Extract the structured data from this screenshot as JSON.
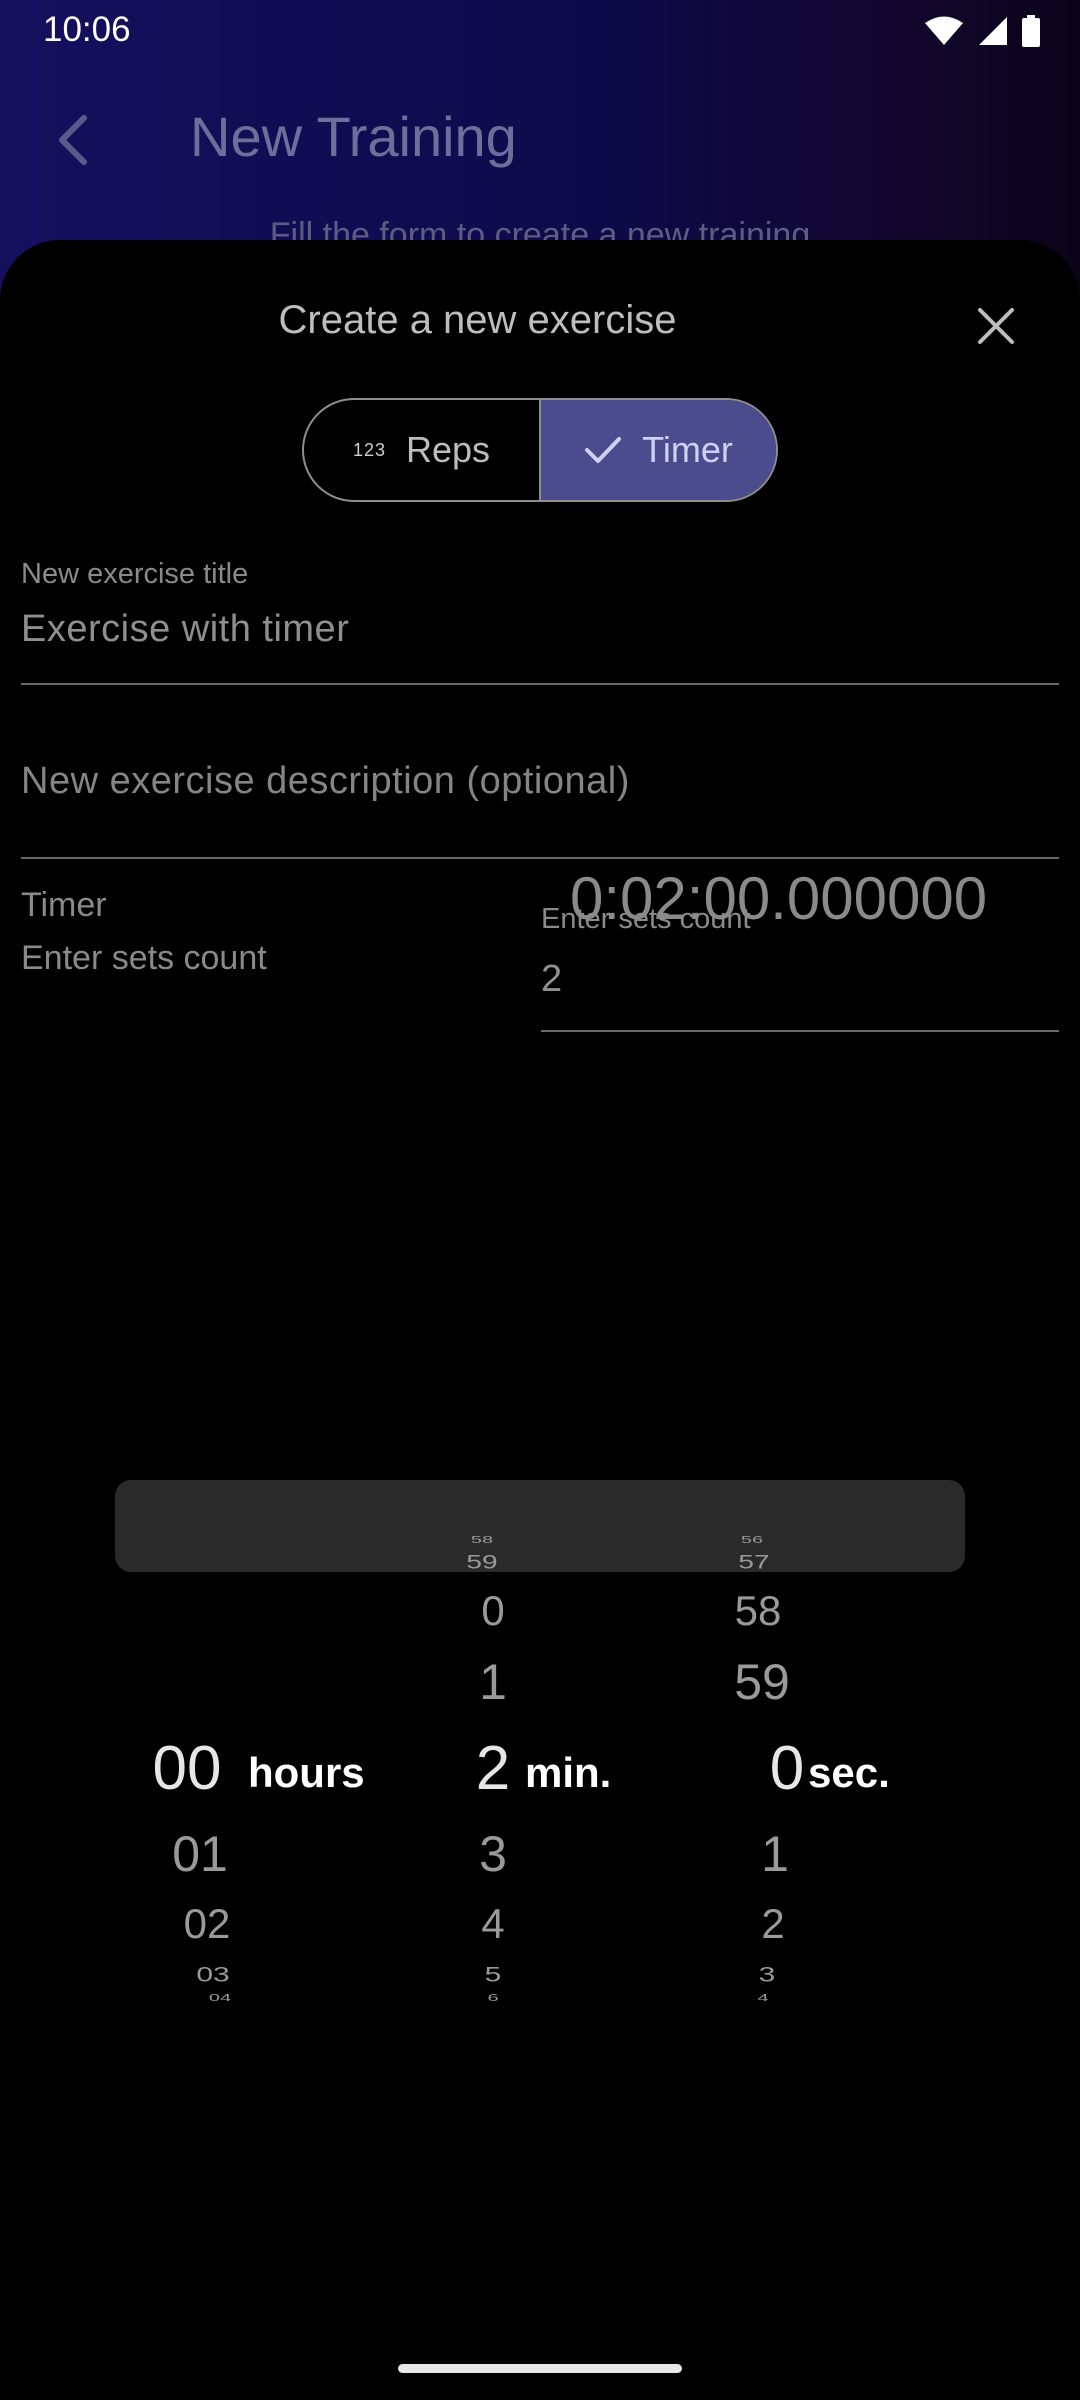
{
  "status_bar": {
    "time": "10:06"
  },
  "background_screen": {
    "title": "New Training",
    "subtitle": "Fill the form to create a new training"
  },
  "sheet": {
    "title": "Create a new exercise",
    "close_icon": "close-icon",
    "mode_toggle": {
      "reps": {
        "icon": "numbers-123-icon",
        "icon_text": "123",
        "label": "Reps",
        "selected": false
      },
      "timer": {
        "icon": "check-icon",
        "label": "Timer",
        "selected": true
      }
    },
    "title_field": {
      "label": "New exercise title",
      "value": "Exercise with timer"
    },
    "description_field": {
      "placeholder": "New exercise description (optional)"
    },
    "sets": {
      "label": "Enter sets count",
      "field_label": "Enter sets count",
      "value": "2"
    },
    "timer": {
      "label": "Timer",
      "value": "0:02:00.000000"
    }
  },
  "picker": {
    "hours": {
      "above": [],
      "selected": "00",
      "below": [
        "01",
        "02",
        "03",
        "04"
      ],
      "unit": "hours"
    },
    "minutes": {
      "above": [
        "58",
        "59",
        "0",
        "1"
      ],
      "selected": "2",
      "below": [
        "3",
        "4",
        "5",
        "6"
      ],
      "unit": "min."
    },
    "seconds": {
      "above": [
        "56",
        "57",
        "58",
        "59"
      ],
      "selected": "0",
      "below": [
        "1",
        "2",
        "3",
        "4"
      ],
      "unit": "sec."
    }
  },
  "colors": {
    "segment_selected": "#4a4c8e",
    "picker_highlight": "#2a2a2a",
    "header_gradient": "#14105e"
  }
}
